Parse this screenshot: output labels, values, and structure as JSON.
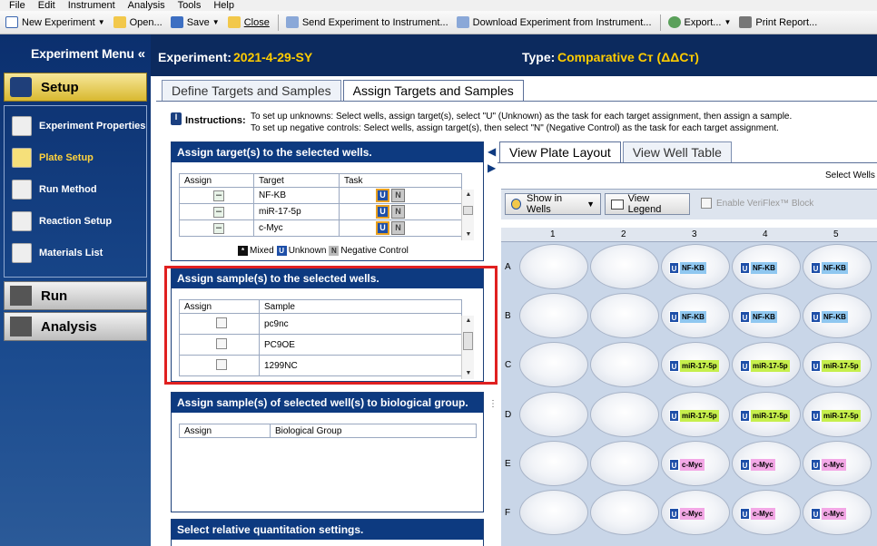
{
  "menubar": [
    "File",
    "Edit",
    "Instrument",
    "Analysis",
    "Tools",
    "Help"
  ],
  "toolbar": {
    "new_experiment": "New Experiment",
    "open": "Open...",
    "save": "Save",
    "close": "Close",
    "send": "Send Experiment to Instrument...",
    "download": "Download Experiment from Instrument...",
    "export": "Export...",
    "print": "Print Report..."
  },
  "sidebar": {
    "title": "Experiment Menu",
    "setup": "Setup",
    "items": [
      {
        "label": "Experiment Properties"
      },
      {
        "label": "Plate Setup"
      },
      {
        "label": "Run Method"
      },
      {
        "label": "Reaction Setup"
      },
      {
        "label": "Materials List"
      }
    ],
    "run": "Run",
    "analysis": "Analysis"
  },
  "header": {
    "experiment_label": "Experiment:",
    "experiment_name": "2021-4-29-SY",
    "type_label": "Type:",
    "type_value": "Comparative Cт (ΔΔCт)"
  },
  "tabs": [
    "Define Targets and Samples",
    "Assign Targets and Samples"
  ],
  "instructions": {
    "label": "Instructions:",
    "line1": "To set up unknowns: Select wells, assign target(s), select \"U\" (Unknown) as the task for each target assignment, then assign a sample.",
    "line2": "To set up negative controls: Select wells, assign target(s), then select \"N\" (Negative Control) as the task for each target assignment."
  },
  "targets_panel": {
    "title": "Assign target(s) to the selected wells.",
    "headers": [
      "Assign",
      "Target",
      "Task"
    ],
    "rows": [
      {
        "target": "NF-KB"
      },
      {
        "target": "miR-17-5p"
      },
      {
        "target": "c-Myc"
      }
    ],
    "task_u": "U",
    "task_n": "N"
  },
  "legend": {
    "mixed": "Mixed",
    "unknown": "Unknown",
    "negative": "Negative Control",
    "u": "U",
    "n": "N"
  },
  "samples_panel": {
    "title": "Assign sample(s) to the selected wells.",
    "headers": [
      "Assign",
      "Sample"
    ],
    "rows": [
      "pc9nc",
      "PC9OE",
      "1299NC"
    ]
  },
  "bio_panel": {
    "title": "Assign sample(s) of selected well(s) to biological group.",
    "headers": [
      "Assign",
      "Biological Group"
    ]
  },
  "quant_panel": {
    "title": "Select relative quantitation settings."
  },
  "right_tabs": [
    "View Plate Layout",
    "View Well Table"
  ],
  "select_wells": "Select Wells W",
  "controls": {
    "show_in_wells": "Show in Wells",
    "view_legend": "View Legend",
    "veriflex": "Enable VeriFlex™ Block"
  },
  "plate": {
    "columns": [
      "1",
      "2",
      "3",
      "4",
      "5"
    ],
    "rows": [
      "A",
      "B",
      "C",
      "D",
      "E",
      "F"
    ],
    "u": "U",
    "wells": [
      [
        "",
        "",
        "NF-KB",
        "NF-KB",
        "NF-KB"
      ],
      [
        "",
        "",
        "NF-KB",
        "NF-KB",
        "NF-KB"
      ],
      [
        "",
        "",
        "miR-17-5p",
        "miR-17-5p",
        "miR-17-5p"
      ],
      [
        "",
        "",
        "miR-17-5p",
        "miR-17-5p",
        "miR-17-5p"
      ],
      [
        "",
        "",
        "c-Myc",
        "c-Myc",
        "c-Myc"
      ],
      [
        "",
        "",
        "c-Myc",
        "c-Myc",
        "c-Myc"
      ]
    ]
  },
  "colors": {
    "nfkb": "#8fc7f0",
    "mir": "#c6ef4c",
    "cmyc": "#f3a8e6",
    "accent": "#ffcc00",
    "navy": "#0c2a5e"
  }
}
